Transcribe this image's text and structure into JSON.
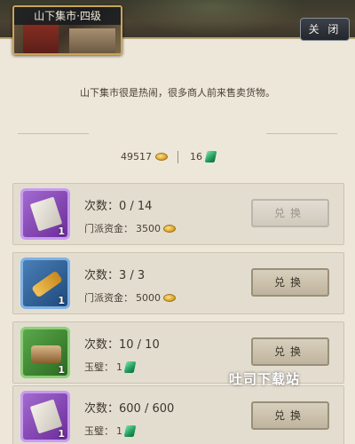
{
  "header": {
    "title": "山下集市·四级",
    "close_label": "关 闭"
  },
  "description": "山下集市很是热闹，很多商人前来售卖货物。",
  "currencies": [
    {
      "amount": "49517",
      "icon": "coin-icon"
    },
    {
      "amount": "16",
      "icon": "jade-icon"
    }
  ],
  "items": [
    {
      "icon": "paper-icon",
      "quality": "purple",
      "count": "1",
      "times": "次数：0 / 14",
      "cost_label": "门派资金：",
      "cost_value": "3500",
      "cost_icon": "coin-icon",
      "button": "兑换",
      "enabled": false
    },
    {
      "icon": "scroll-icon",
      "quality": "blue",
      "count": "1",
      "times": "次数：3 / 3",
      "cost_label": "门派资金：",
      "cost_value": "5000",
      "cost_icon": "coin-icon",
      "button": "兑换",
      "enabled": true
    },
    {
      "icon": "wood-icon",
      "quality": "green",
      "count": "1",
      "times": "次数：10 / 10",
      "cost_label": "玉璧：",
      "cost_value": "1",
      "cost_icon": "jade-icon",
      "button": "兑换",
      "enabled": true
    },
    {
      "icon": "paper-icon",
      "quality": "purple",
      "count": "1",
      "times": "次数：600 / 600",
      "cost_label": "玉璧：",
      "cost_value": "1",
      "cost_icon": "jade-icon",
      "button": "兑换",
      "enabled": true
    }
  ],
  "watermark": "吐司下载站"
}
